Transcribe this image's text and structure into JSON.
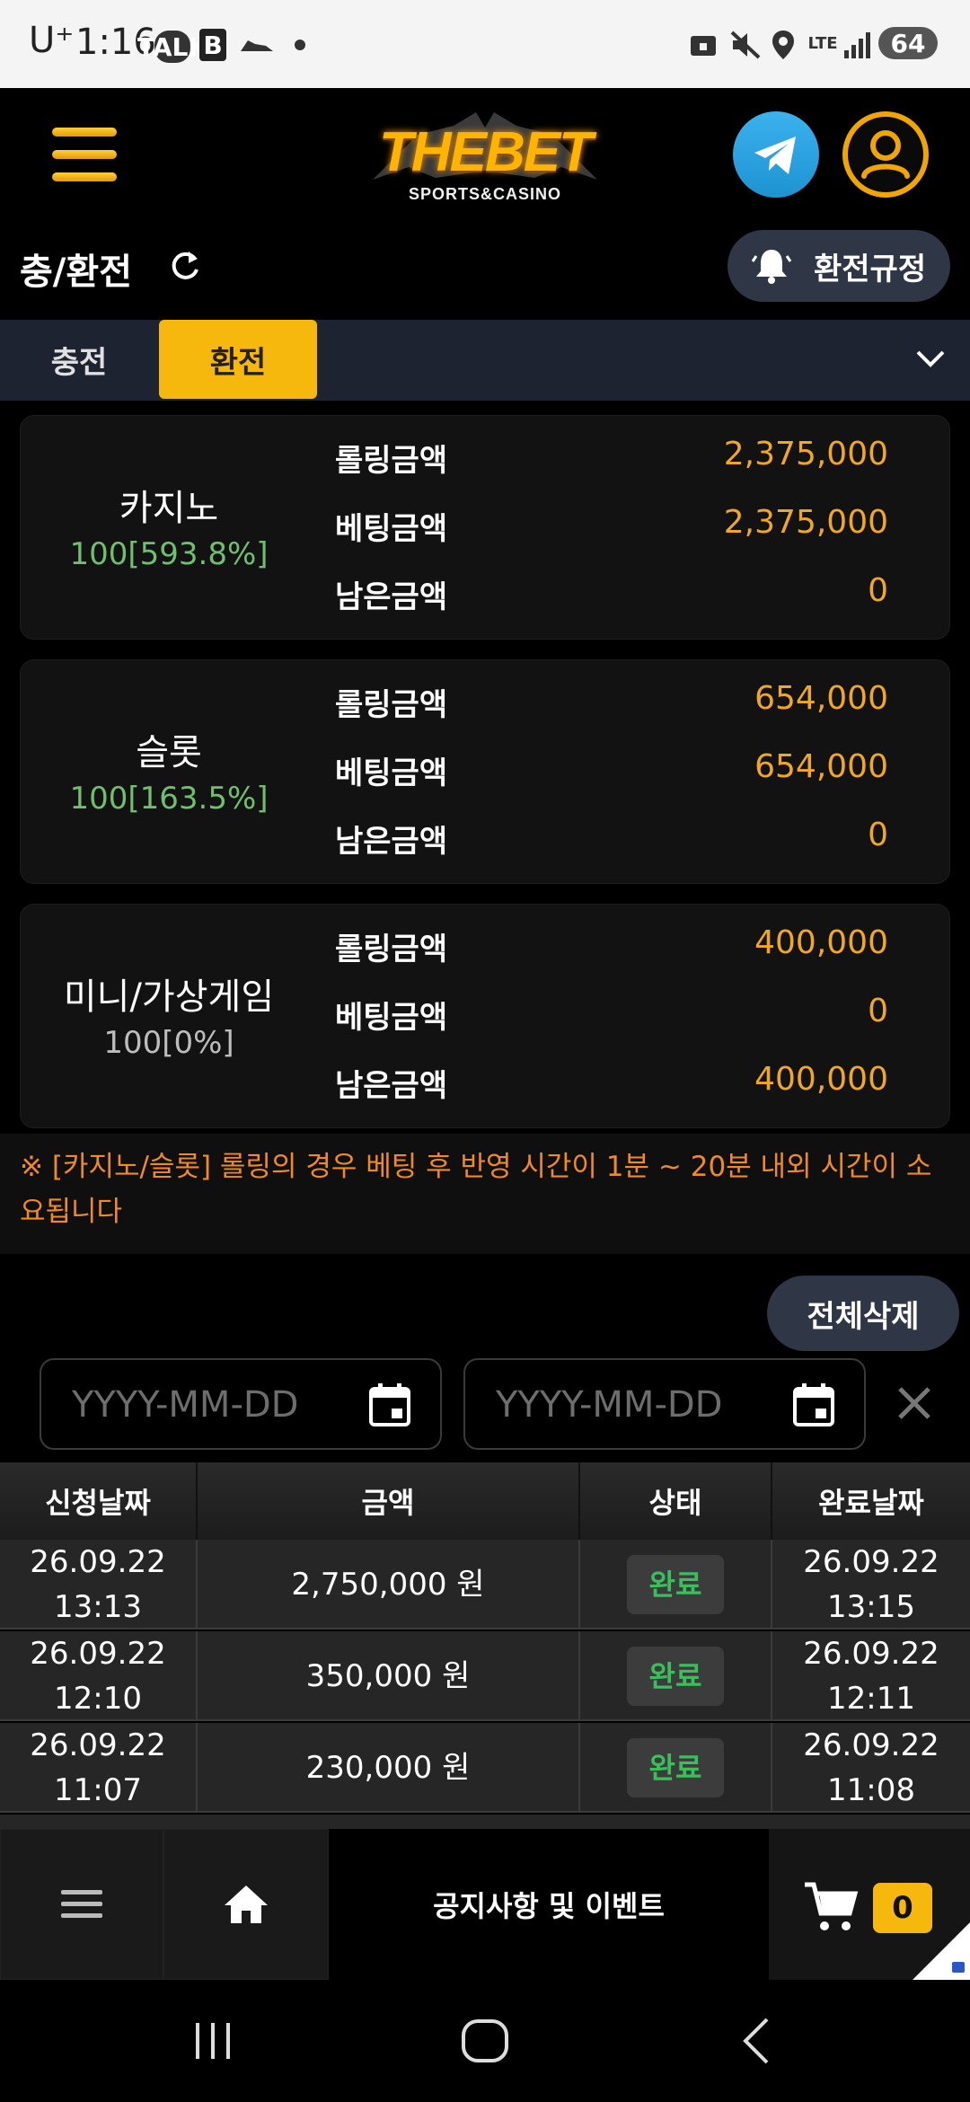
{
  "status_bar": {
    "carrier": "U⁺",
    "time": "1:16",
    "talk": "TALK",
    "b_app": "B",
    "network": "LTE",
    "battery": "64"
  },
  "header": {
    "logo_main": "THEBET",
    "logo_sub": "SPORTS&CASINO"
  },
  "page": {
    "title": "충/환전",
    "rules_button": "환전규정"
  },
  "tabs": {
    "charge": "충전",
    "exchange": "환전"
  },
  "cards": [
    {
      "name": "카지노",
      "rate": "100[593.8%]",
      "rate_color": "#6fbf6f",
      "rows": [
        {
          "label": "롤링금액",
          "value": "2,375,000"
        },
        {
          "label": "베팅금액",
          "value": "2,375,000"
        },
        {
          "label": "남은금액",
          "value": "0"
        }
      ]
    },
    {
      "name": "슬롯",
      "rate": "100[163.5%]",
      "rate_color": "#6fbf6f",
      "rows": [
        {
          "label": "롤링금액",
          "value": "654,000"
        },
        {
          "label": "베팅금액",
          "value": "654,000"
        },
        {
          "label": "남은금액",
          "value": "0"
        }
      ]
    },
    {
      "name": "미니/가상게임",
      "rate": "100[0%]",
      "rate_color": "#bdbdbd",
      "rows": [
        {
          "label": "롤링금액",
          "value": "400,000"
        },
        {
          "label": "베팅금액",
          "value": "0"
        },
        {
          "label": "남은금액",
          "value": "400,000"
        }
      ]
    }
  ],
  "notice": {
    "line1": "※ [카지노/슬롯] 롤링의 경우 베팅 후 반영 시간이 1분 ~ 20분 내외 시간이 소",
    "line2": "요됩니다"
  },
  "filters": {
    "delete_all": "전체삭제",
    "start_placeholder": "YYYY-MM-DD",
    "end_placeholder": "YYYY-MM-DD"
  },
  "table": {
    "headers": [
      "신청날짜",
      "금액",
      "상태",
      "완료날짜"
    ],
    "rows": [
      {
        "req_date": "26.09.22",
        "req_time": "13:13",
        "amount": "2,750,000 원",
        "status": "완료",
        "done_date": "26.09.22",
        "done_time": "13:15"
      },
      {
        "req_date": "26.09.22",
        "req_time": "12:10",
        "amount": "350,000 원",
        "status": "완료",
        "done_date": "26.09.22",
        "done_time": "12:11"
      },
      {
        "req_date": "26.09.22",
        "req_time": "11:07",
        "amount": "230,000 원",
        "status": "완료",
        "done_date": "26.09.22",
        "done_time": "11:08"
      }
    ]
  },
  "bottom_nav": {
    "notice_events": "공지사항 및 이벤트",
    "cart_count": "0"
  },
  "colors": {
    "accent": "#f7b80e",
    "value": "#f0a722",
    "notice": "#f08a23",
    "status_done": "#3bbf5d"
  }
}
